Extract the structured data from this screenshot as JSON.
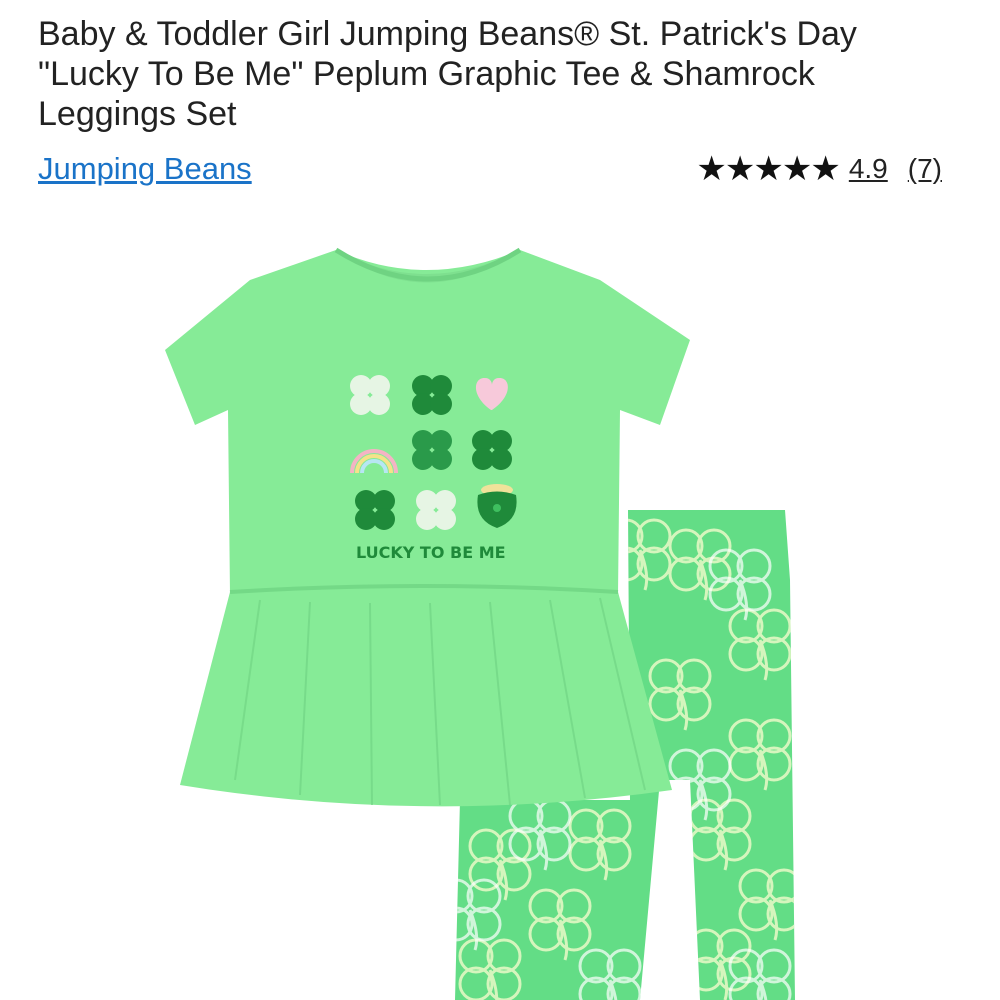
{
  "product": {
    "title": "Baby & Toddler Girl Jumping Beans® St. Patrick's Day \"Lucky To Be Me\" Peplum Graphic Tee & Shamrock Leggings Set",
    "brand": "Jumping Beans",
    "rating": {
      "stars": 5,
      "star_glyphs": "★★★★★",
      "value": "4.9",
      "count": "(7)"
    },
    "image": {
      "shirt_text": "LUCKY TO BE ME",
      "colors": {
        "shirt": "#86eb97",
        "leggings": "#63dd86",
        "shamrock_dark": "#1f8a3a",
        "shamrock_light": "#e3f5e3",
        "heart": "#f7c9da"
      }
    }
  }
}
